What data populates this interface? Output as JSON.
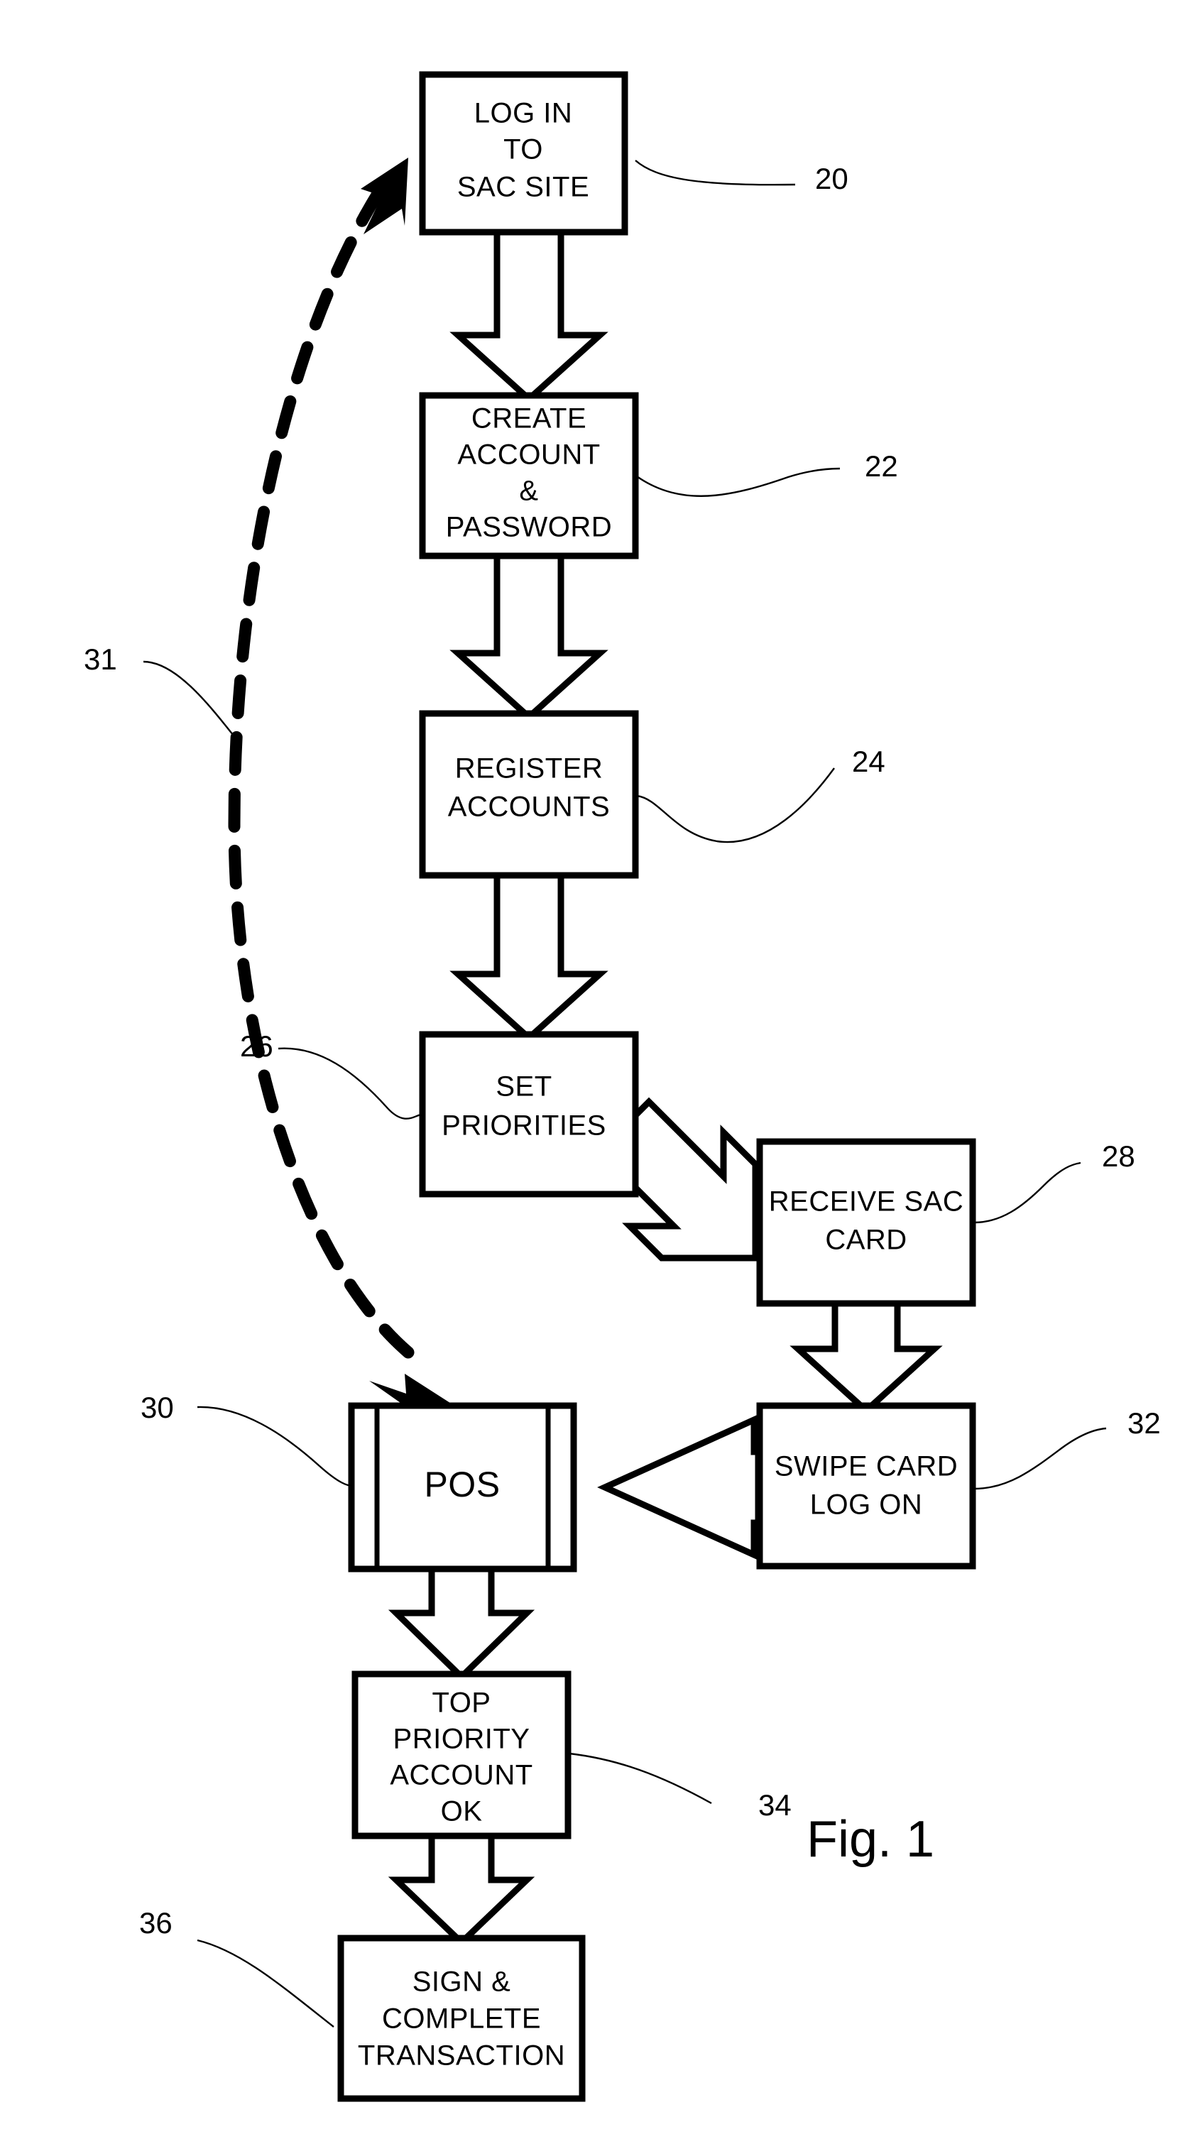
{
  "figure": {
    "caption": "Fig. 1",
    "type": "patent-flow-diagram"
  },
  "nodes": [
    {
      "id": "login",
      "ref": "20",
      "lines": [
        "LOG IN",
        "TO",
        "SAC SITE"
      ]
    },
    {
      "id": "create-account",
      "ref": "22",
      "lines": [
        "CREATE",
        "ACCOUNT",
        "&",
        "PASSWORD"
      ]
    },
    {
      "id": "register-accounts",
      "ref": "24",
      "lines": [
        "REGISTER",
        "ACCOUNTS"
      ]
    },
    {
      "id": "set-priorities",
      "ref": "26",
      "lines": [
        "SET",
        "PRIORITIES"
      ]
    },
    {
      "id": "receive-sac-card",
      "ref": "28",
      "lines": [
        "RECEIVE SAC",
        "CARD"
      ]
    },
    {
      "id": "pos",
      "ref": "30",
      "lines": [
        "POS"
      ]
    },
    {
      "id": "swipe-card",
      "ref": "32",
      "lines": [
        "SWIPE CARD",
        "LOG ON"
      ]
    },
    {
      "id": "top-priority-ok",
      "ref": "34",
      "lines": [
        "TOP",
        "PRIORITY",
        "ACCOUNT",
        "OK"
      ]
    },
    {
      "id": "sign-complete",
      "ref": "36",
      "lines": [
        "SIGN &",
        "COMPLETE",
        "TRANSACTION"
      ]
    }
  ],
  "connectors": [
    {
      "id": "feedback-loop",
      "ref": "31",
      "style": "dashed",
      "from": "pos",
      "to": "login"
    }
  ],
  "reference_numerals": {
    "login": "20",
    "create_account": "22",
    "register_accounts": "24",
    "set_priorities": "26",
    "receive_sac_card": "28",
    "pos": "30",
    "feedback_loop": "31",
    "swipe_card": "32",
    "top_priority_ok": "34",
    "sign_complete": "36"
  },
  "colors": {
    "line": "#000000",
    "fill": "#ffffff",
    "background": "#ffffff"
  }
}
